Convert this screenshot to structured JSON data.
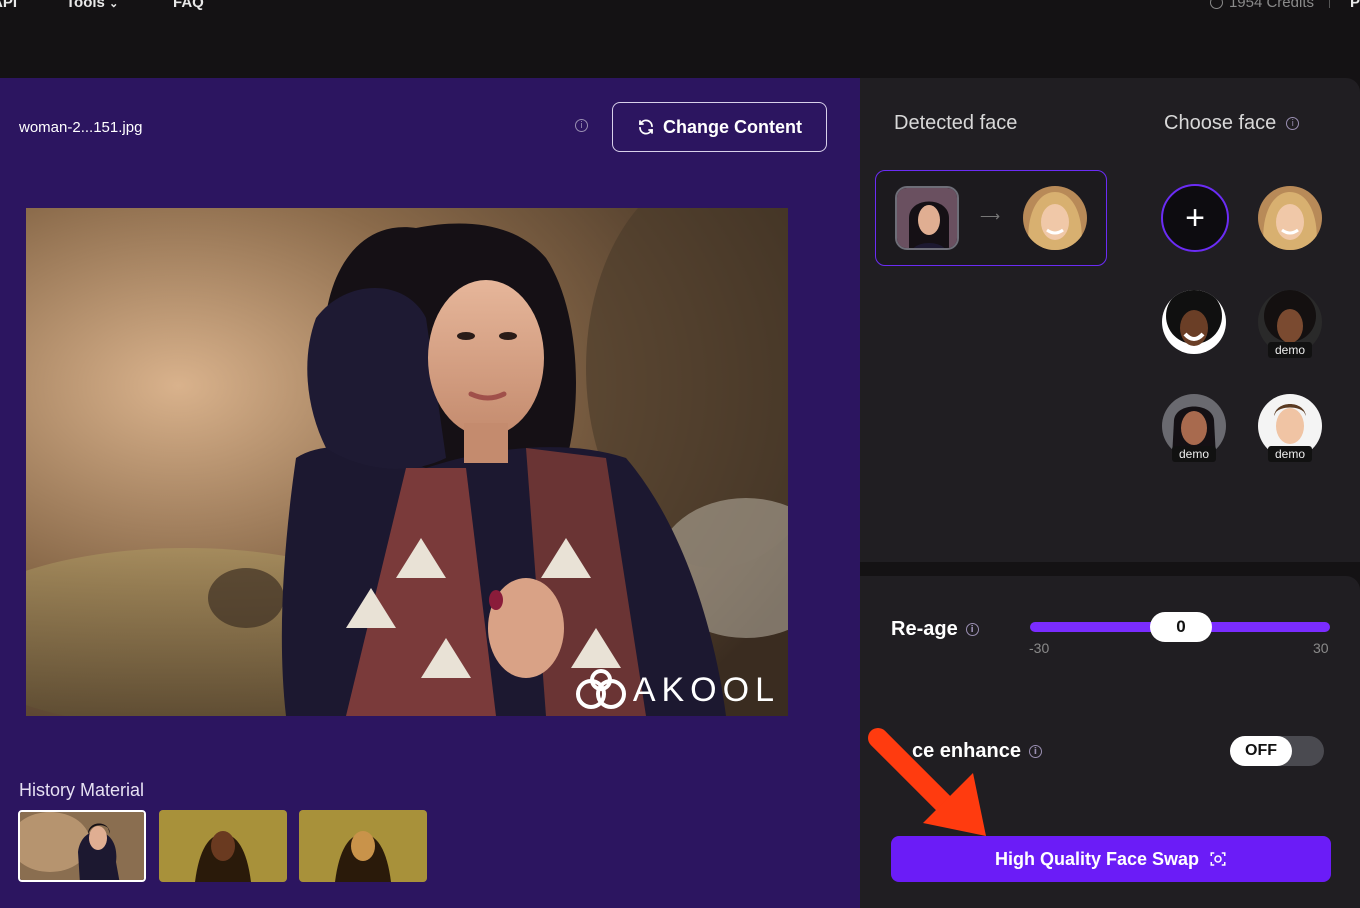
{
  "nav": {
    "items": [
      "API",
      "Tools",
      "FAQ"
    ],
    "credits": "1954 Credits",
    "tail": "P"
  },
  "editor": {
    "filename": "woman-2...151.jpg",
    "change_content_label": "Change Content",
    "history_title": "History Material",
    "watermark": "AKOOL"
  },
  "faces": {
    "detected_title": "Detected face",
    "choose_title": "Choose face",
    "demo_label": "demo",
    "add_symbol": "+"
  },
  "settings": {
    "reage_label": "Re-age",
    "reage_value": "0",
    "reage_min": "-30",
    "reage_max": "30",
    "enhance_label": "ce enhance",
    "enhance_state": "OFF",
    "swap_button_label": "High Quality Face Swap"
  },
  "colors": {
    "editor_bg": "#2c1560",
    "accent": "#6b1cf7",
    "panel_bg": "#201e22",
    "annotation_arrow": "#ff3b0f"
  }
}
